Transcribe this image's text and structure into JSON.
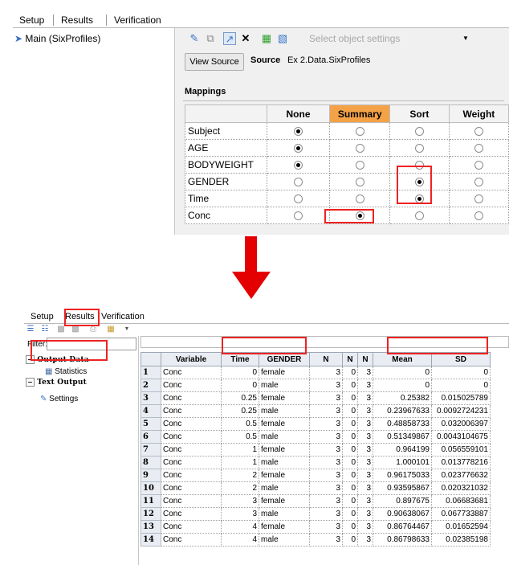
{
  "top": {
    "tabs": [
      "Setup",
      "Results",
      "Verification"
    ],
    "tree_item": "Main (SixProfiles)",
    "select_placeholder": "Select object settings",
    "view_source_label": "View Source",
    "source_label": "Source",
    "source_value": "Ex 2.Data.SixProfiles",
    "mappings_label": "Mappings",
    "columns": [
      "None",
      "Summary",
      "Sort",
      "Weight"
    ],
    "rows": [
      {
        "name": "Subject",
        "selected": "None"
      },
      {
        "name": "AGE",
        "selected": "None"
      },
      {
        "name": "BODYWEIGHT",
        "selected": "None"
      },
      {
        "name": "GENDER",
        "selected": "Sort"
      },
      {
        "name": "Time",
        "selected": "Sort"
      },
      {
        "name": "Conc",
        "selected": "Summary"
      }
    ]
  },
  "bottom": {
    "tabs": [
      "Setup",
      "Results",
      "Verification"
    ],
    "filter_label": "Filter:",
    "tree": {
      "output_data": "Output Data",
      "statistics": "Statistics",
      "text_output": "Text Output",
      "settings": "Settings"
    },
    "columns": [
      "Variable",
      "Time",
      "GENDER",
      "N",
      "N",
      "N",
      "Mean",
      "SD"
    ],
    "rows": [
      [
        "1",
        "Conc",
        "0",
        "female",
        "3",
        "0",
        "3",
        "0",
        "0"
      ],
      [
        "2",
        "Conc",
        "0",
        "male",
        "3",
        "0",
        "3",
        "0",
        "0"
      ],
      [
        "3",
        "Conc",
        "0.25",
        "female",
        "3",
        "0",
        "3",
        "0.25382",
        "0.015025789"
      ],
      [
        "4",
        "Conc",
        "0.25",
        "male",
        "3",
        "0",
        "3",
        "0.23967633",
        "0.0092724231"
      ],
      [
        "5",
        "Conc",
        "0.5",
        "female",
        "3",
        "0",
        "3",
        "0.48858733",
        "0.032006397"
      ],
      [
        "6",
        "Conc",
        "0.5",
        "male",
        "3",
        "0",
        "3",
        "0.51349867",
        "0.0043104675"
      ],
      [
        "7",
        "Conc",
        "1",
        "female",
        "3",
        "0",
        "3",
        "0.964199",
        "0.056559101"
      ],
      [
        "8",
        "Conc",
        "1",
        "male",
        "3",
        "0",
        "3",
        "1.000101",
        "0.013778216"
      ],
      [
        "9",
        "Conc",
        "2",
        "female",
        "3",
        "0",
        "3",
        "0.96175033",
        "0.023776632"
      ],
      [
        "10",
        "Conc",
        "2",
        "male",
        "3",
        "0",
        "3",
        "0.93595867",
        "0.020321032"
      ],
      [
        "11",
        "Conc",
        "3",
        "female",
        "3",
        "0",
        "3",
        "0.897675",
        "0.06683681"
      ],
      [
        "12",
        "Conc",
        "3",
        "male",
        "3",
        "0",
        "3",
        "0.90638067",
        "0.067733887"
      ],
      [
        "13",
        "Conc",
        "4",
        "female",
        "3",
        "0",
        "3",
        "0.86764467",
        "0.01652594"
      ],
      [
        "14",
        "Conc",
        "4",
        "male",
        "3",
        "0",
        "3",
        "0.86798633",
        "0.02385198"
      ]
    ]
  },
  "colors": {
    "highlight": "#e22222",
    "summary_header": "#f4a247",
    "arrow": "#e40000"
  }
}
